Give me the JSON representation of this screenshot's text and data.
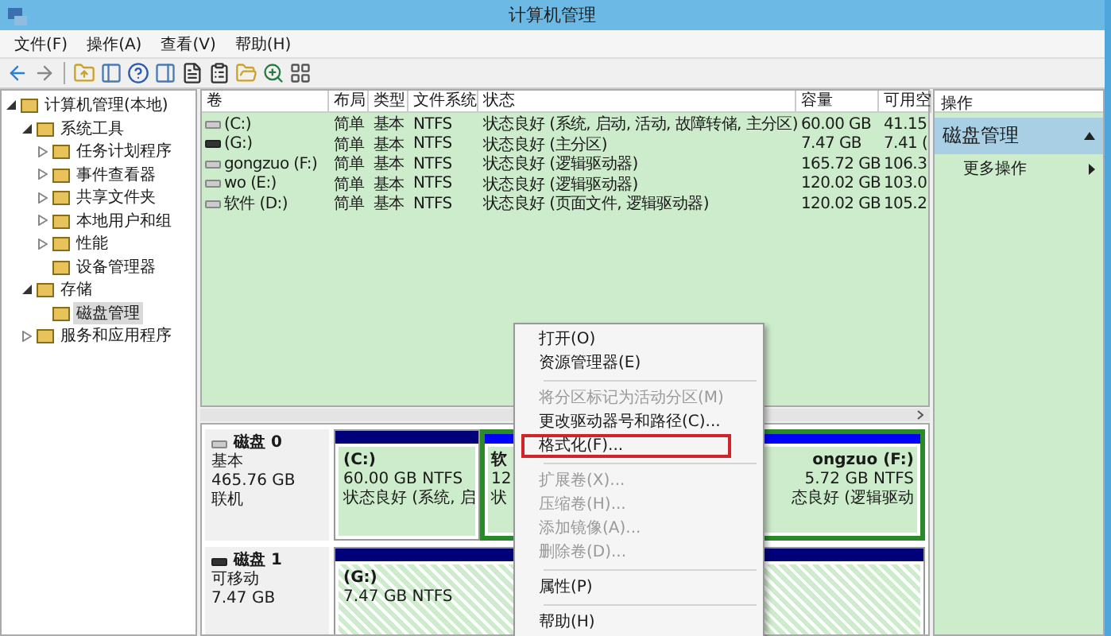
{
  "window": {
    "title": "计算机管理"
  },
  "menu": [
    "文件(F)",
    "操作(A)",
    "查看(V)",
    "帮助(H)"
  ],
  "tree": [
    {
      "label": "计算机管理(本地)",
      "kind": "branch",
      "expanded": true,
      "selected": false,
      "children": [
        {
          "label": "系统工具",
          "kind": "branch",
          "expanded": true,
          "selected": false,
          "children": [
            {
              "label": "任务计划程序",
              "kind": "branch",
              "expanded": false,
              "selected": false
            },
            {
              "label": "事件查看器",
              "kind": "branch",
              "expanded": false,
              "selected": false
            },
            {
              "label": "共享文件夹",
              "kind": "branch",
              "expanded": false,
              "selected": false
            },
            {
              "label": "本地用户和组",
              "kind": "branch",
              "expanded": false,
              "selected": false
            },
            {
              "label": "性能",
              "kind": "branch",
              "expanded": false,
              "selected": false
            },
            {
              "label": "设备管理器",
              "kind": "leaf",
              "selected": false
            }
          ]
        },
        {
          "label": "存储",
          "kind": "branch",
          "expanded": true,
          "selected": false,
          "children": [
            {
              "label": "磁盘管理",
              "kind": "leaf",
              "selected": true
            }
          ]
        },
        {
          "label": "服务和应用程序",
          "kind": "branch",
          "expanded": false,
          "selected": false
        }
      ]
    }
  ],
  "table": {
    "columns": [
      "卷",
      "布局",
      "类型",
      "文件系统",
      "状态",
      "容量",
      "可用空"
    ],
    "rows": [
      {
        "removable": false,
        "cells": [
          "(C:)",
          "简单",
          "基本",
          "NTFS",
          "状态良好 (系统, 启动, 活动, 故障转储, 主分区)",
          "60.00 GB",
          "41.15"
        ]
      },
      {
        "removable": true,
        "cells": [
          "(G:)",
          "简单",
          "基本",
          "NTFS",
          "状态良好 (主分区)",
          "7.47 GB",
          "7.41 ("
        ]
      },
      {
        "removable": false,
        "cells": [
          "gongzuo (F:)",
          "简单",
          "基本",
          "NTFS",
          "状态良好 (逻辑驱动器)",
          "165.72 GB",
          "106.3"
        ]
      },
      {
        "removable": false,
        "cells": [
          "wo (E:)",
          "简单",
          "基本",
          "NTFS",
          "状态良好 (逻辑驱动器)",
          "120.02 GB",
          "103.0"
        ]
      },
      {
        "removable": false,
        "cells": [
          "软件 (D:)",
          "简单",
          "基本",
          "NTFS",
          "状态良好 (页面文件, 逻辑驱动器)",
          "120.02 GB",
          "105.2"
        ]
      }
    ]
  },
  "disks": [
    {
      "name": "磁盘 0",
      "removable": false,
      "lines": [
        "基本",
        "465.76 GB",
        "联机"
      ],
      "partitions": [
        {
          "kind": "primary",
          "title": "(C:)",
          "lines": [
            "60.00 GB NTFS",
            "状态良好 (系统, 启"
          ]
        },
        {
          "kind": "extended",
          "selected": true,
          "children": [
            {
              "title": "软",
              "lines": [
                "12",
                "状"
              ]
            },
            {
              "title": "ongzuo  (F:)",
              "lines": [
                "5.72 GB NTFS",
                "态良好 (逻辑驱动"
              ]
            }
          ]
        }
      ]
    },
    {
      "name": "磁盘 1",
      "removable": true,
      "lines": [
        "可移动",
        "7.47 GB"
      ],
      "partitions": [
        {
          "kind": "removable",
          "title": "(G:)",
          "lines": [
            "7.47 GB NTFS"
          ]
        }
      ]
    }
  ],
  "actions": {
    "title": "操作",
    "section": "磁盘管理",
    "items": [
      "更多操作"
    ]
  },
  "context_menu": [
    {
      "kind": "item",
      "label": "打开(O)",
      "disabled": false,
      "highlighted": false
    },
    {
      "kind": "item",
      "label": "资源管理器(E)",
      "disabled": false,
      "highlighted": false
    },
    {
      "kind": "separator"
    },
    {
      "kind": "item",
      "label": "将分区标记为活动分区(M)",
      "disabled": true,
      "highlighted": false
    },
    {
      "kind": "item",
      "label": "更改驱动器号和路径(C)...",
      "disabled": false,
      "highlighted": false
    },
    {
      "kind": "item",
      "label": "格式化(F)...",
      "disabled": false,
      "highlighted": true
    },
    {
      "kind": "separator"
    },
    {
      "kind": "item",
      "label": "扩展卷(X)...",
      "disabled": true,
      "highlighted": false
    },
    {
      "kind": "item",
      "label": "压缩卷(H)...",
      "disabled": true,
      "highlighted": false
    },
    {
      "kind": "item",
      "label": "添加镜像(A)...",
      "disabled": true,
      "highlighted": false
    },
    {
      "kind": "item",
      "label": "删除卷(D)...",
      "disabled": true,
      "highlighted": false
    },
    {
      "kind": "separator"
    },
    {
      "kind": "item",
      "label": "属性(P)",
      "disabled": false,
      "highlighted": false
    },
    {
      "kind": "separator"
    },
    {
      "kind": "item",
      "label": "帮助(H)",
      "disabled": false,
      "highlighted": false
    }
  ]
}
